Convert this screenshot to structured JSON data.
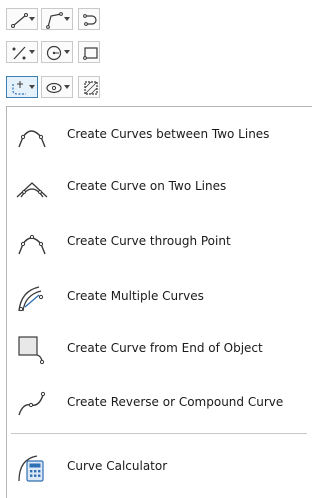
{
  "toolbar": {
    "buttons": [
      {
        "name": "line-tool-icon"
      },
      {
        "name": "polyline-tool-icon"
      },
      {
        "name": "arc-tool-icon"
      },
      {
        "name": "point-tool-icon"
      },
      {
        "name": "circle-tool-icon"
      },
      {
        "name": "rectangle-tool-icon"
      },
      {
        "name": "curve-tool-icon"
      },
      {
        "name": "ellipse-tool-icon"
      },
      {
        "name": "hatch-tool-icon"
      }
    ]
  },
  "menu": {
    "items": [
      {
        "label": "Create Curves between Two Lines",
        "icon": "curve-between-lines-icon"
      },
      {
        "label": "Create Curve on Two Lines",
        "icon": "curve-on-lines-icon"
      },
      {
        "label": "Create Curve through Point",
        "icon": "curve-through-point-icon"
      },
      {
        "label": "Create Multiple Curves",
        "icon": "multiple-curves-icon"
      },
      {
        "label": "Create Curve from End of Object",
        "icon": "curve-from-end-icon"
      },
      {
        "label": "Create Reverse or Compound Curve",
        "icon": "reverse-compound-curve-icon"
      },
      {
        "label": "Curve Calculator",
        "icon": "curve-calculator-icon"
      }
    ]
  },
  "colors": {
    "icon_stroke": "#3a3a3a",
    "icon_accent": "#2f6fb3",
    "active_bg": "#e5f1fb"
  }
}
